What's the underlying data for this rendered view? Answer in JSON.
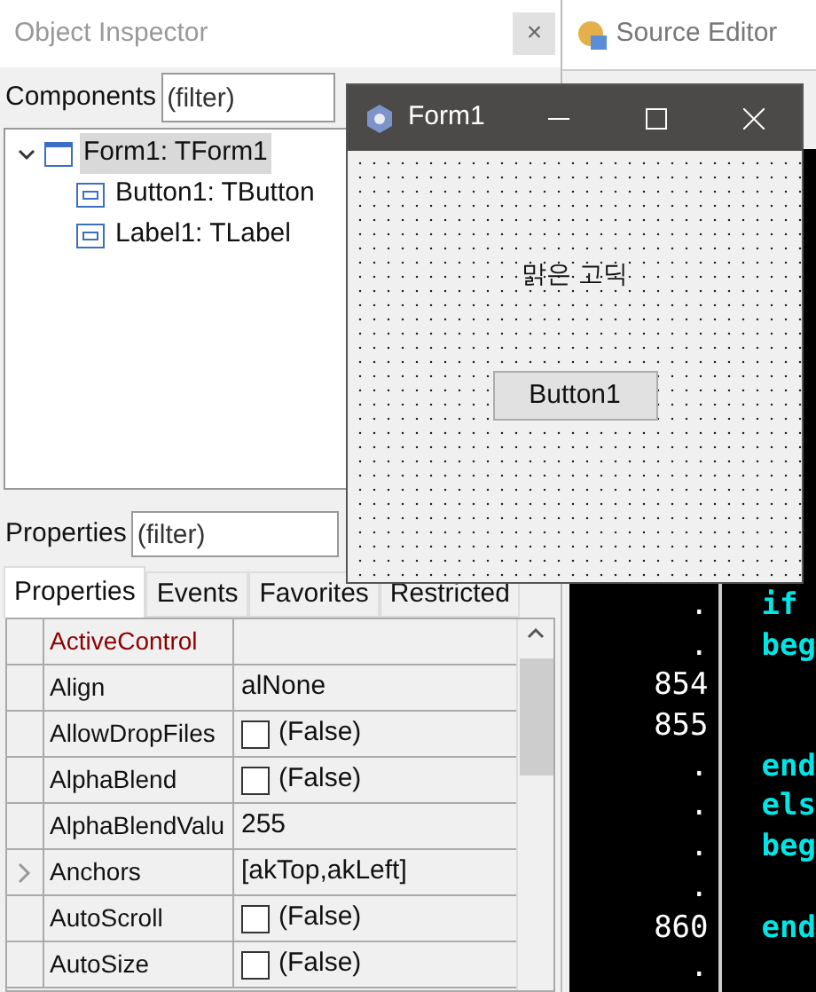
{
  "inspector": {
    "title": "Object Inspector",
    "close": "×",
    "components_label": "Components",
    "components_filter": {
      "placeholder": "(filter)"
    },
    "tree": [
      {
        "label": "Form1: TForm1",
        "selected": true,
        "expanded": true,
        "children": [
          {
            "label": "Button1: TButton",
            "selected": false
          },
          {
            "label": "Label1: TLabel",
            "selected": false
          }
        ]
      }
    ],
    "properties_label": "Properties",
    "properties_filter": {
      "placeholder": "(filter)"
    },
    "tabs": [
      {
        "label": "Properties",
        "selected": true
      },
      {
        "label": "Events",
        "selected": false
      },
      {
        "label": "Favorites",
        "selected": false
      },
      {
        "label": "Restricted",
        "selected": false
      }
    ],
    "grid": [
      {
        "name": "ActiveControl",
        "kind": "text",
        "highlighted": true
      },
      {
        "name": "Align",
        "kind": "text",
        "value": "alNone"
      },
      {
        "name": "AllowDropFiles",
        "kind": "check",
        "checked": false,
        "value": "(False)"
      },
      {
        "name": "AlphaBlend",
        "kind": "check",
        "checked": false,
        "value": "(False)"
      },
      {
        "name": "AlphaBlendValu",
        "kind": "text",
        "value": "255"
      },
      {
        "name": "Anchors",
        "kind": "text",
        "value": "[akTop,akLeft]",
        "expandable": true
      },
      {
        "name": "AutoScroll",
        "kind": "check",
        "checked": false,
        "value": "(False)"
      },
      {
        "name": "AutoSize",
        "kind": "check",
        "checked": false,
        "value": "(False)"
      }
    ]
  },
  "source_editor": {
    "title": "Source Editor",
    "lines": [
      {
        "number": ".",
        "code": "if"
      },
      {
        "number": ".",
        "code": "beg"
      },
      {
        "number": "854"
      },
      {
        "number": "855"
      },
      {
        "number": ".",
        "code": "end"
      },
      {
        "number": ".",
        "code": "els"
      },
      {
        "number": ".",
        "code": "beg"
      },
      {
        "number": "."
      },
      {
        "number": "860",
        "code": "end"
      },
      {
        "number": "."
      }
    ]
  },
  "form_window": {
    "title": "Form1",
    "label": "맑은 고딕",
    "button": "Button1"
  }
}
